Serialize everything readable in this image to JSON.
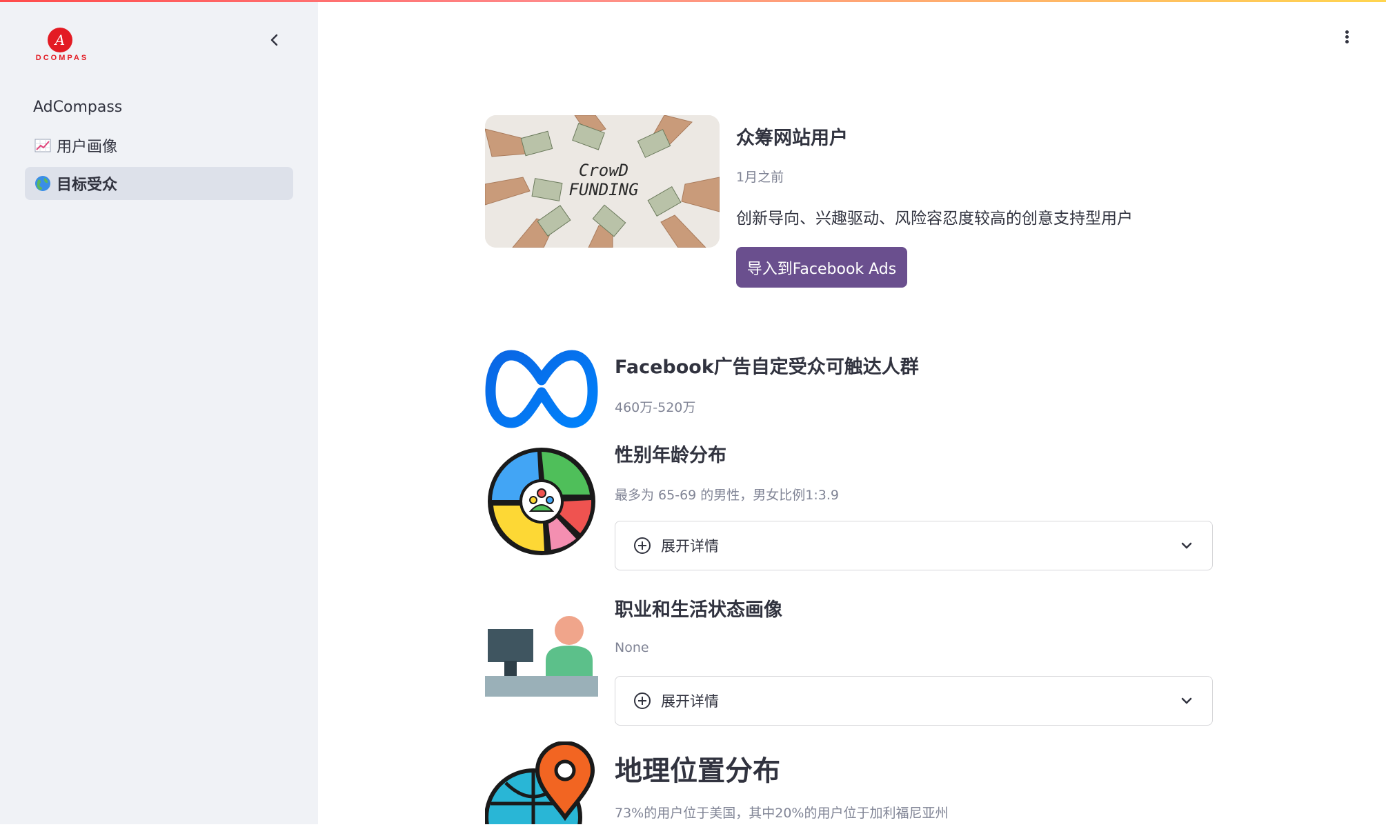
{
  "brand": {
    "logo_letter": "A",
    "logo_text": "DCOMPAS"
  },
  "sidebar": {
    "title": "AdCompass",
    "items": [
      {
        "label": "用户画像",
        "icon": "chart-increasing-icon",
        "active": false
      },
      {
        "label": "目标受众",
        "icon": "globe-icon",
        "active": true
      }
    ]
  },
  "hero": {
    "image_text_line1": "CrowD",
    "image_text_line2": "FUNDING",
    "title": "众筹网站用户",
    "time": "1月之前",
    "description": "创新导向、兴趣驱动、风险容忍度较高的创意支持型用户",
    "import_button": "导入到Facebook Ads"
  },
  "sections": [
    {
      "title": "Facebook广告自定受众可触达人群",
      "subtitle": "460万-520万",
      "icon": "meta-logo-icon"
    },
    {
      "title": "性别年龄分布",
      "subtitle": "最多为 65-69 的男性，男女比例1:3.9",
      "icon": "audience-pie-icon",
      "expander": "展开详情"
    },
    {
      "title": "职业和生活状态画像",
      "subtitle": "None",
      "icon": "office-worker-icon",
      "expander": "展开详情"
    },
    {
      "title": "地理位置分布",
      "subtitle": "73%的用户位于美国，其中20%的用户位于加利福尼亚州",
      "icon": "globe-location-icon"
    }
  ],
  "colors": {
    "accent": "#ff4b4b",
    "button": "#6a4f8e",
    "sidebar_bg": "#f0f2f6",
    "active_item": "#dde1ea"
  }
}
